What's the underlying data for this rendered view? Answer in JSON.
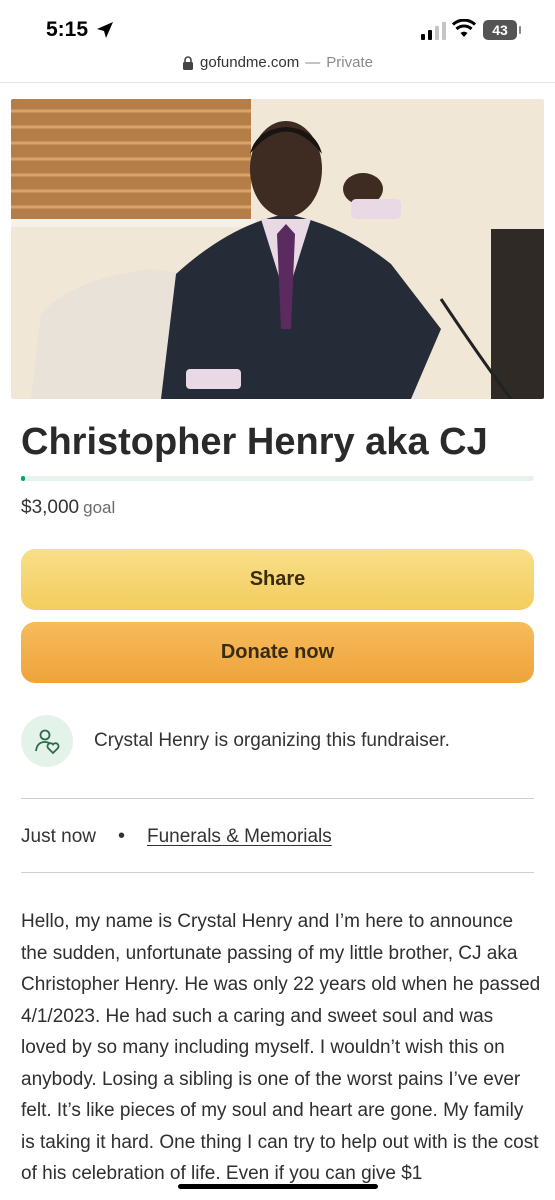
{
  "status_bar": {
    "time": "5:15",
    "battery": "43"
  },
  "url_bar": {
    "domain": "gofundme.com",
    "separator": "—",
    "mode": "Private"
  },
  "campaign": {
    "title": "Christopher Henry aka CJ",
    "progress_fraction": 0.005,
    "amount": "$3,000",
    "goal_label": "goal",
    "share_label": "Share",
    "donate_label": "Donate now",
    "organizer_text": "Crystal Henry is organizing this fundraiser.",
    "posted": "Just now",
    "category": "Funerals & Memorials",
    "story": "Hello, my name is Crystal Henry and I’m here to announce the sudden, unfortunate passing of my little brother, CJ aka Christopher Henry. He was only 22 years old when he passed 4/1/2023. He had such a caring and sweet soul and was loved by so many including myself. I wouldn’t wish this on anybody. Losing a sibling is one of the worst pains I’ve ever felt. It’s like pieces of my soul and heart are gone. My family is taking it hard. One thing I can try to help out with is the cost of his celebration of life. Even if you can give $1"
  },
  "colors": {
    "accent": "#02a95c",
    "share_button": "#f5d572",
    "donate_button": "#f2ad48"
  },
  "icons": [
    "location-arrow-icon",
    "signal-icon",
    "wifi-icon",
    "battery-icon",
    "lock-icon",
    "organizer-heart-icon"
  ]
}
